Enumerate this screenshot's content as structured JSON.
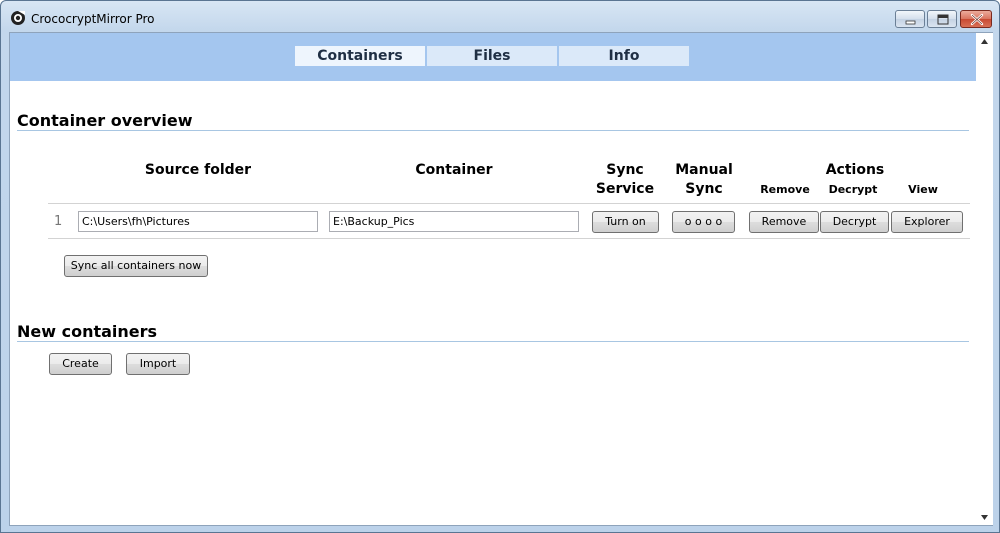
{
  "window": {
    "title": "CrococryptMirror Pro"
  },
  "tabs": [
    {
      "label": "Containers",
      "active": true
    },
    {
      "label": "Files",
      "active": false
    },
    {
      "label": "Info",
      "active": false
    }
  ],
  "overview": {
    "title": "Container overview",
    "headers": {
      "source_folder": "Source folder",
      "container": "Container",
      "sync_service_line1": "Sync",
      "sync_service_line2": "Service",
      "manual_sync_line1": "Manual",
      "manual_sync_line2": "Sync",
      "actions": "Actions",
      "remove": "Remove",
      "decrypt": "Decrypt",
      "view": "View"
    },
    "rows": [
      {
        "index": "1",
        "source": "C:\\Users\\fh\\Pictures",
        "container": "E:\\Backup_Pics",
        "sync_button": "Turn on",
        "manual_button": "o o o o",
        "remove_button": "Remove",
        "decrypt_button": "Decrypt",
        "explorer_button": "Explorer"
      }
    ],
    "sync_all_button": "Sync all containers now"
  },
  "new_containers": {
    "title": "New containers",
    "create_button": "Create",
    "import_button": "Import"
  },
  "colors": {
    "header_band": "#a4c6ef",
    "tab_background": "#dbe9f9",
    "section_line": "#a8c6e2"
  },
  "icons": {
    "app": "crocodile-eye-icon",
    "minimize": "minimize-icon",
    "maximize": "maximize-icon",
    "close": "close-icon"
  }
}
